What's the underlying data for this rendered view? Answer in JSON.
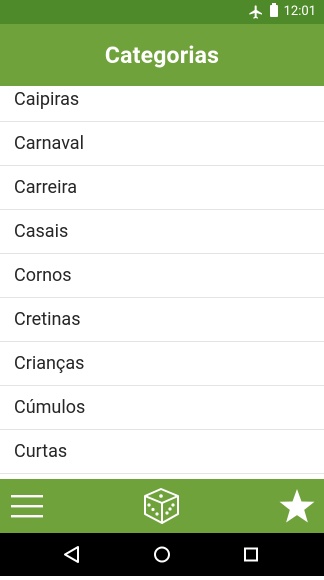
{
  "status_bar": {
    "time": "12:01",
    "icons": [
      "airplane-mode-icon",
      "battery-icon"
    ]
  },
  "app_bar": {
    "title": "Categorias"
  },
  "categories": [
    "Caipiras",
    "Carnaval",
    "Carreira",
    "Casais",
    "Cornos",
    "Cretinas",
    "Crianças",
    "Cúmulos",
    "Curtas",
    ""
  ],
  "bottom_bar": {
    "icons": [
      "menu-icon",
      "dice-icon",
      "star-icon"
    ]
  },
  "nav_bar": {
    "icons": [
      "back-icon",
      "home-icon",
      "recents-icon"
    ]
  },
  "colors": {
    "primary": "#6fa23a",
    "status_bar": "#4f8a2a",
    "divider": "#e4e4e4",
    "text": "#262626"
  }
}
